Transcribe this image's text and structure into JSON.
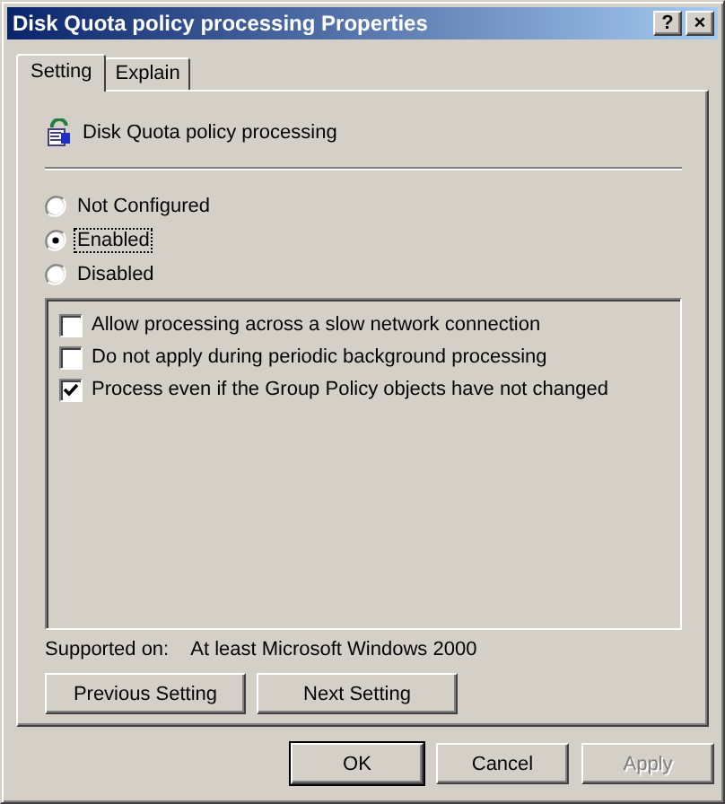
{
  "window": {
    "title": "Disk Quota policy processing Properties",
    "title_buttons": [
      "?",
      "×"
    ]
  },
  "tabs": [
    {
      "label": "Setting",
      "selected": true
    },
    {
      "label": "Explain",
      "selected": false
    }
  ],
  "policy": {
    "name": "Disk Quota policy processing"
  },
  "options": [
    {
      "label": "Not Configured",
      "selected": false,
      "focused": false
    },
    {
      "label": "Enabled",
      "selected": true,
      "focused": true
    },
    {
      "label": "Disabled",
      "selected": false,
      "focused": false
    }
  ],
  "settings": [
    {
      "label": "Allow processing across a slow network connection",
      "checked": false
    },
    {
      "label": "Do not apply during periodic background processing",
      "checked": false
    },
    {
      "label": "Process even if the Group Policy objects have not changed",
      "checked": true
    }
  ],
  "supported": {
    "label": "Supported on:",
    "value": "At least Microsoft Windows 2000"
  },
  "nav_buttons": [
    "Previous Setting",
    "Next Setting"
  ],
  "buttons": [
    {
      "label": "OK",
      "default": true,
      "disabled": false
    },
    {
      "label": "Cancel",
      "default": false,
      "disabled": false
    },
    {
      "label": "Apply",
      "default": false,
      "disabled": true
    }
  ]
}
